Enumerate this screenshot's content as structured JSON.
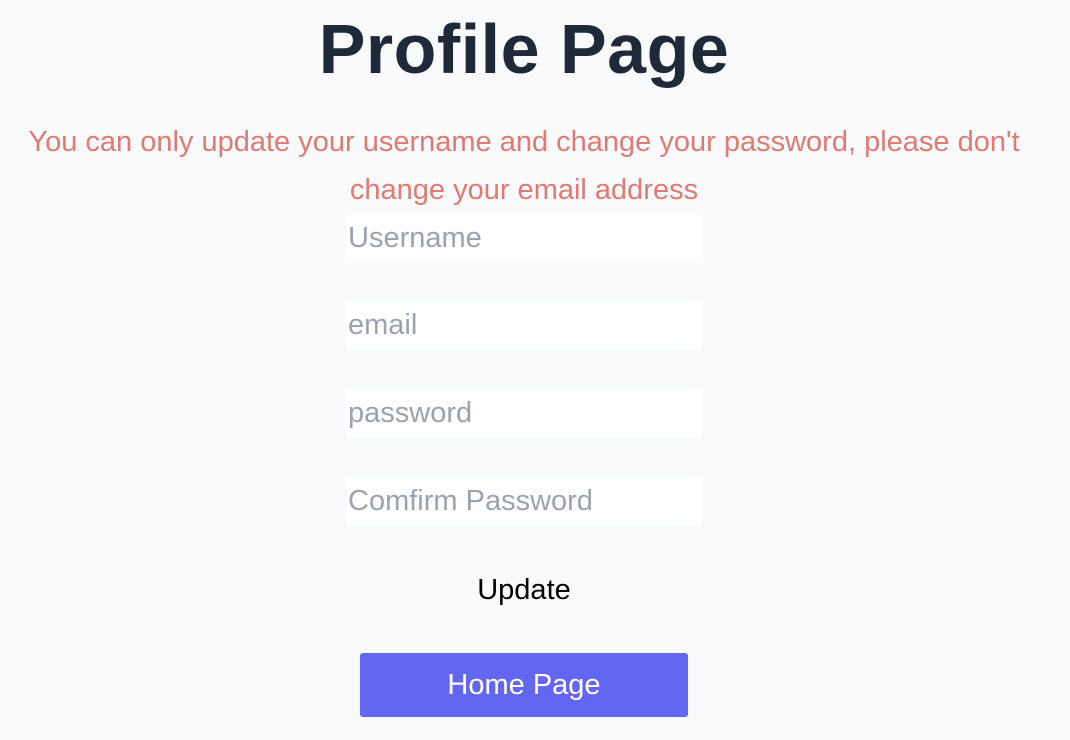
{
  "page": {
    "title": "Profile Page",
    "notice": "You can only update your username and change your password, please don't change your email address"
  },
  "form": {
    "username": {
      "value": "",
      "placeholder": "Username"
    },
    "email": {
      "value": "",
      "placeholder": "email"
    },
    "password": {
      "value": "",
      "placeholder": "password"
    },
    "confirm_password": {
      "value": "",
      "placeholder": "Comfirm Password"
    },
    "update_label": "Update"
  },
  "navigation": {
    "home_label": "Home Page"
  },
  "colors": {
    "background": "#f8fafc",
    "title": "#1f2937",
    "notice": "#e07a73",
    "placeholder": "#9ca3af",
    "primary_button": "#6366f1"
  }
}
